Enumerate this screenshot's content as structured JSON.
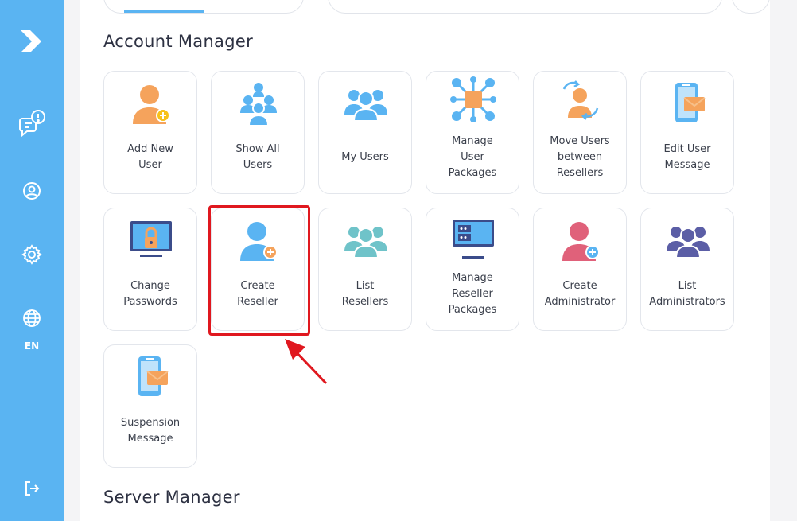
{
  "sidebar": {
    "language": "EN"
  },
  "sections": {
    "account_manager": "Account Manager",
    "server_manager": "Server Manager"
  },
  "cards": [
    {
      "label": "Add New\nUser",
      "icon": "add-user-icon"
    },
    {
      "label": "Show All\nUsers",
      "icon": "all-users-icon"
    },
    {
      "label": "My Users",
      "icon": "my-users-icon"
    },
    {
      "label": "Manage\nUser\nPackages",
      "icon": "package-network-icon"
    },
    {
      "label": "Move Users\nbetween\nResellers",
      "icon": "move-user-icon"
    },
    {
      "label": "Edit User\nMessage",
      "icon": "phone-message-icon"
    },
    {
      "label": "Change\nPasswords",
      "icon": "monitor-lock-icon"
    },
    {
      "label": "Create\nReseller",
      "icon": "add-reseller-icon"
    },
    {
      "label": "List\nResellers",
      "icon": "resellers-group-icon"
    },
    {
      "label": "Manage\nReseller\nPackages",
      "icon": "monitor-server-icon"
    },
    {
      "label": "Create\nAdministrator",
      "icon": "add-admin-icon"
    },
    {
      "label": "List\nAdministrators",
      "icon": "admins-group-icon"
    },
    {
      "label": "Suspension\nMessage",
      "icon": "phone-message-icon"
    }
  ],
  "colors": {
    "sidebar": "#5ab4f2",
    "highlight": "#e0181f",
    "orange": "#f5a35c",
    "blue": "#5ab4f2",
    "teal": "#6fc3c9",
    "pink": "#e0617a",
    "indigo": "#5b5ea6"
  }
}
